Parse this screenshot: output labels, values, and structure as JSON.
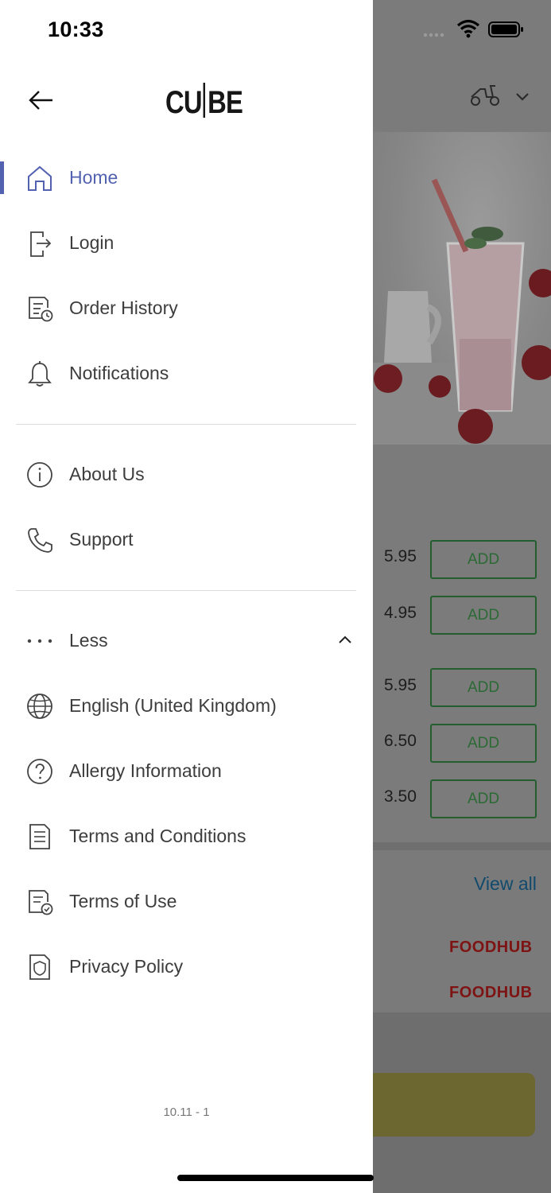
{
  "status_bar": {
    "time": "10:33"
  },
  "drawer": {
    "logo": {
      "left": "CU",
      "right": "BE"
    },
    "items": [
      {
        "label": "Home",
        "icon": "home-icon",
        "active": true
      },
      {
        "label": "Login",
        "icon": "login-icon"
      },
      {
        "label": "Order History",
        "icon": "order-history-icon"
      },
      {
        "label": "Notifications",
        "icon": "bell-icon"
      },
      {
        "label": "About Us",
        "icon": "info-icon"
      },
      {
        "label": "Support",
        "icon": "phone-icon"
      },
      {
        "label": "Less",
        "icon": "more-dots-icon"
      },
      {
        "label": "English (United Kingdom)",
        "icon": "globe-icon"
      },
      {
        "label": "Allergy Information",
        "icon": "question-icon"
      },
      {
        "label": "Terms and Conditions",
        "icon": "document-icon"
      },
      {
        "label": "Terms of Use",
        "icon": "document-check-icon"
      },
      {
        "label": "Privacy Policy",
        "icon": "shield-icon"
      }
    ],
    "version": "10.11 - 1",
    "accent_color": "#5262b0"
  },
  "background": {
    "prices": [
      "5.95",
      "4.95",
      "5.95",
      "6.50",
      "3.50"
    ],
    "add_label": "ADD",
    "view_all": "View all",
    "brand_badges": [
      "FOODHUB",
      "FOODHUB"
    ]
  }
}
